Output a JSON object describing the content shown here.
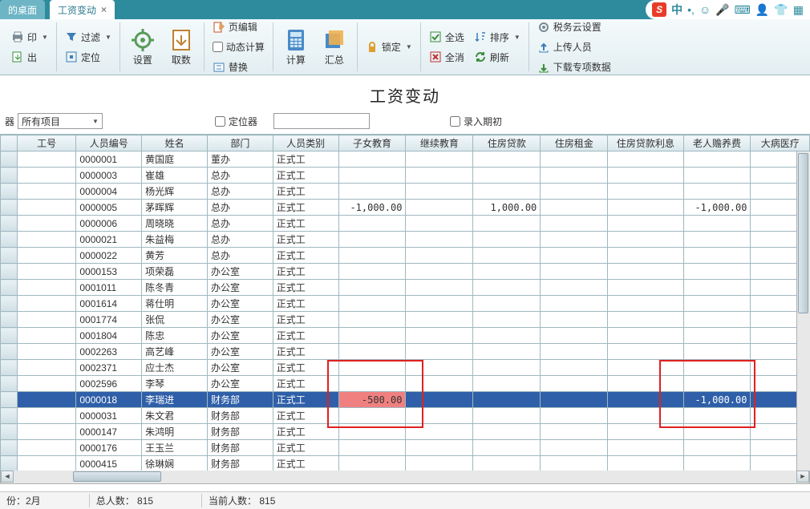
{
  "tabs": {
    "inactive": "的桌面",
    "active": "工资变动"
  },
  "ribbon": {
    "print": "印",
    "export": "出",
    "filter": "过滤",
    "locate": "定位",
    "settings": "设置",
    "fetch": "取数",
    "pageedit": "页编辑",
    "dyncalc": "动态计算",
    "replace": "替换",
    "calc": "计算",
    "summary": "汇总",
    "lock": "锁定",
    "selall": "全选",
    "selnone": "全消",
    "sort": "排序",
    "refresh": "刷新",
    "tax": "税务云设置",
    "upload": "上传人员",
    "download": "下载专项数据"
  },
  "title": "工资变动",
  "filter": {
    "item_dd": "所有项目",
    "locator": "定位器",
    "period": "录入期初"
  },
  "columns": [
    "",
    "工号",
    "人员编号",
    "姓名",
    "部门",
    "人员类别",
    "子女教育",
    "继续教育",
    "住房贷款",
    "住房租金",
    "住房贷款利息",
    "老人赡养费",
    "大病医疗"
  ],
  "rows": [
    {
      "id": "0000001",
      "name": "黄国庭",
      "dept": "董办",
      "type": "正式工"
    },
    {
      "id": "0000003",
      "name": "崔雄",
      "dept": "总办",
      "type": "正式工"
    },
    {
      "id": "0000004",
      "name": "杨光辉",
      "dept": "总办",
      "type": "正式工"
    },
    {
      "id": "0000005",
      "name": "茅晖辉",
      "dept": "总办",
      "type": "正式工",
      "c1": "-1,000.00",
      "c3": "1,000.00",
      "c6": "-1,000.00"
    },
    {
      "id": "0000006",
      "name": "周晓晓",
      "dept": "总办",
      "type": "正式工"
    },
    {
      "id": "0000021",
      "name": "朱益梅",
      "dept": "总办",
      "type": "正式工"
    },
    {
      "id": "0000022",
      "name": "黄芳",
      "dept": "总办",
      "type": "正式工"
    },
    {
      "id": "0000153",
      "name": "项荣磊",
      "dept": "办公室",
      "type": "正式工"
    },
    {
      "id": "0001011",
      "name": "陈冬青",
      "dept": "办公室",
      "type": "正式工"
    },
    {
      "id": "0001614",
      "name": "蒋仕明",
      "dept": "办公室",
      "type": "正式工"
    },
    {
      "id": "0001774",
      "name": "张侃",
      "dept": "办公室",
      "type": "正式工"
    },
    {
      "id": "0001804",
      "name": "陈忠",
      "dept": "办公室",
      "type": "正式工"
    },
    {
      "id": "0002263",
      "name": "高艺峰",
      "dept": "办公室",
      "type": "正式工"
    },
    {
      "id": "0002371",
      "name": "应士杰",
      "dept": "办公室",
      "type": "正式工"
    },
    {
      "id": "0002596",
      "name": "李琴",
      "dept": "办公室",
      "type": "正式工"
    },
    {
      "id": "0000018",
      "name": "李瑞进",
      "dept": "财务部",
      "type": "正式工",
      "c1": "-500.00",
      "c6": "-1,000.00",
      "selected": true
    },
    {
      "id": "0000031",
      "name": "朱文君",
      "dept": "财务部",
      "type": "正式工"
    },
    {
      "id": "0000147",
      "name": "朱鸿明",
      "dept": "财务部",
      "type": "正式工"
    },
    {
      "id": "0000176",
      "name": "王玉兰",
      "dept": "财务部",
      "type": "正式工"
    },
    {
      "id": "0000415",
      "name": "徐琳娴",
      "dept": "财务部",
      "type": "正式工"
    }
  ],
  "status": {
    "month": "份：2月",
    "total": "总人数： 815",
    "current": "当前人数： 815"
  },
  "ime": {
    "zhong": "中"
  }
}
